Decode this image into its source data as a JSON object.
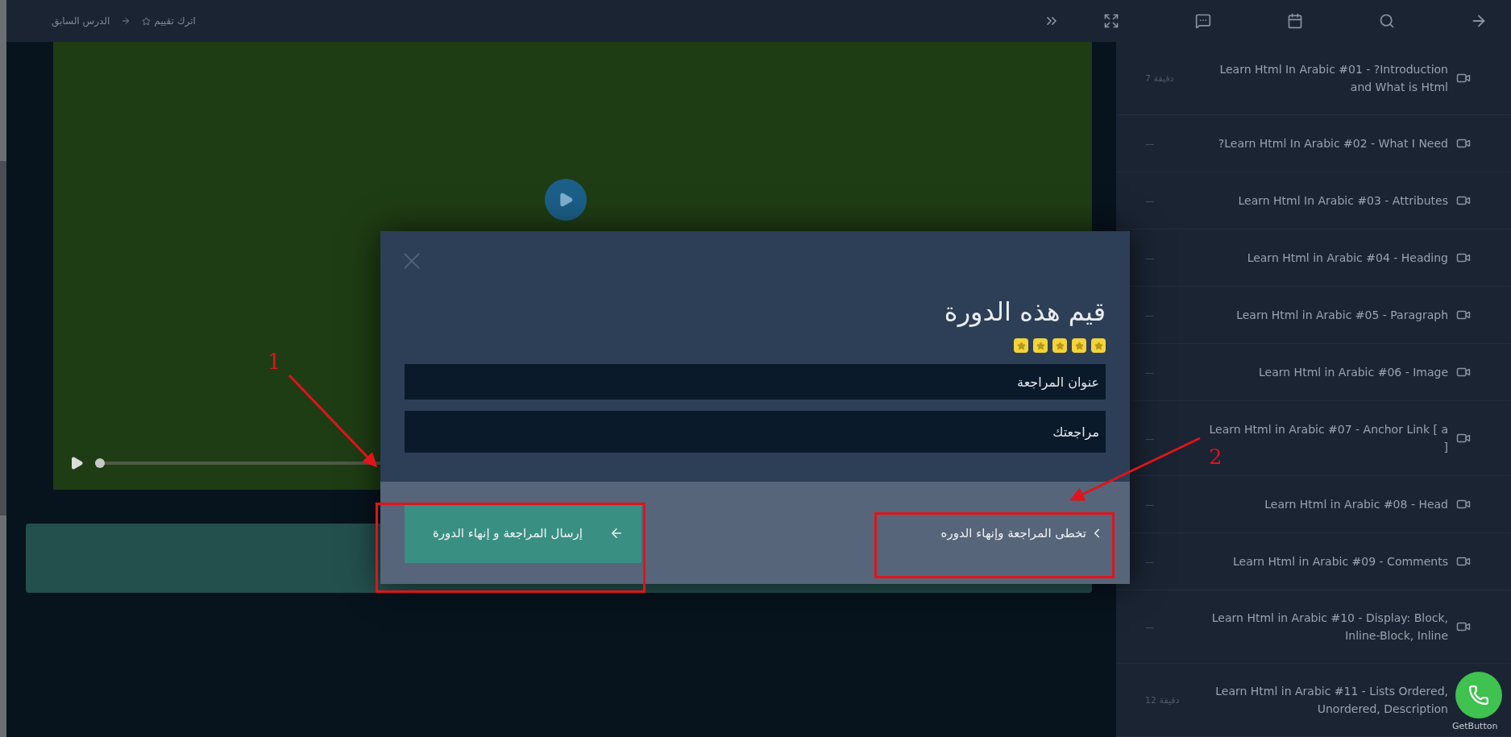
{
  "top_bar": {
    "rate_link": "اترك تقييم",
    "previous_link": "الدرس السابق"
  },
  "video": {
    "progress": {
      "level": 0.0
    }
  },
  "modal": {
    "title": "قيم هذه الدورة",
    "stars": 5,
    "title_field": {
      "placeholder": "عنوان المراجعة"
    },
    "review_field": {
      "placeholder": "مراجعتك"
    },
    "skip_link": "تخطى المراجعة وإنهاء الدوره",
    "submit_button": "إرسال المراجعة و إنهاء الدورة"
  },
  "lessons": [
    {
      "title": "Learn Html In Arabic #01 - ?Introduction and What is Html",
      "duration": "7 دقيقة"
    },
    {
      "title": "?Learn Html In Arabic #02 - What I Need",
      "duration": "—"
    },
    {
      "title": "Learn Html In Arabic #03 - Attributes",
      "duration": "—"
    },
    {
      "title": "Learn Html in Arabic #04 - Heading",
      "duration": "—"
    },
    {
      "title": "Learn Html in Arabic #05 - Paragraph",
      "duration": "—"
    },
    {
      "title": "Learn Html in Arabic #06 - Image",
      "duration": "—"
    },
    {
      "title": "Learn Html in Arabic #07 - Anchor Link [ a ]",
      "duration": "—"
    },
    {
      "title": "Learn Html in Arabic #08 - Head",
      "duration": "—"
    },
    {
      "title": "Learn Html in Arabic #09 - Comments",
      "duration": "—"
    },
    {
      "title": "Learn Html in Arabic #10 - Display: Block, Inline-Block, Inline",
      "duration": "—"
    },
    {
      "title": "Learn Html in Arabic #11 - Lists Ordered, Unordered, Description",
      "duration": "12 دقيقة"
    }
  ],
  "annotations": [
    {
      "label": "1"
    },
    {
      "label": "2"
    }
  ],
  "whatsapp": {
    "label": "GetButton"
  }
}
